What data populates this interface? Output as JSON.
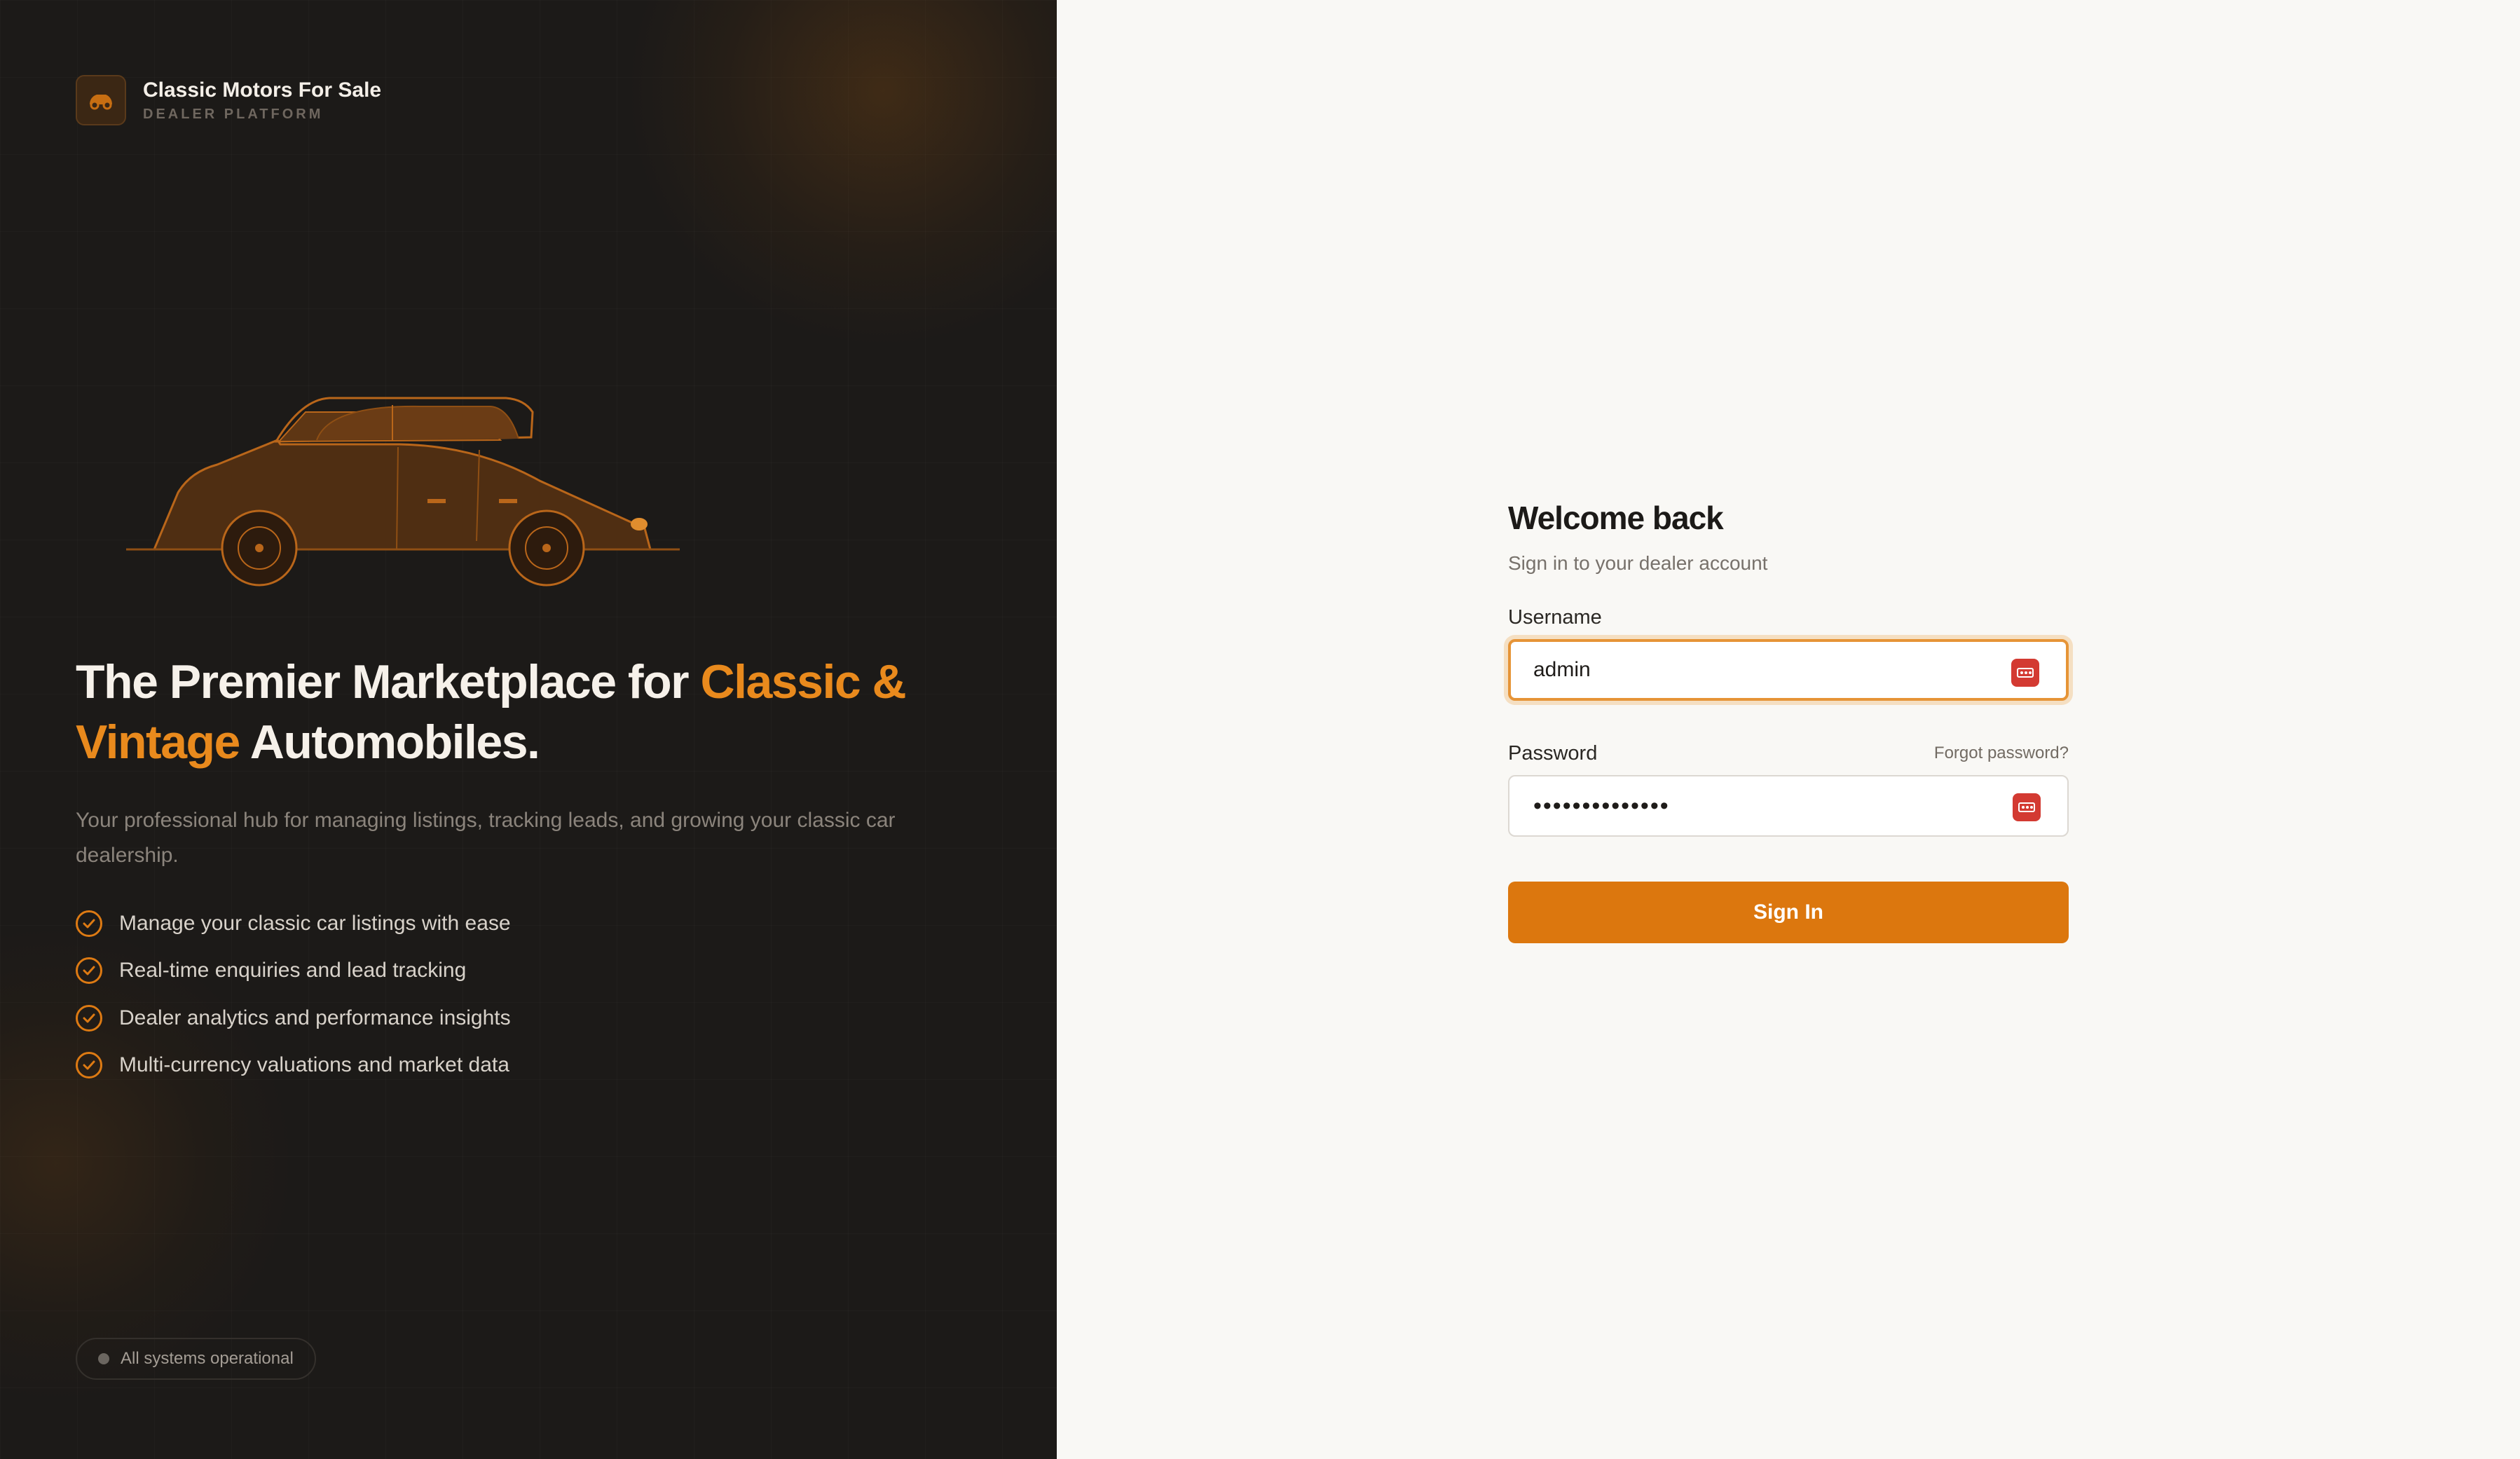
{
  "brand": {
    "name": "Classic Motors For Sale",
    "subtitle": "DEALER PLATFORM",
    "logo_icon": "car-icon"
  },
  "hero": {
    "headline_part1": "The Premier Marketplace for ",
    "headline_accent": "Classic & Vintage",
    "headline_part2": " Automobiles.",
    "description": "Your professional hub for managing listings, tracking leads, and growing your classic car dealership.",
    "illustration_icon": "vintage-car-icon"
  },
  "features": [
    "Manage your classic car listings with ease",
    "Real-time enquiries and lead tracking",
    "Dealer analytics and performance insights",
    "Multi-currency valuations and market data"
  ],
  "status": {
    "text": "All systems operational"
  },
  "login": {
    "title": "Welcome back",
    "subtitle": "Sign in to your dealer account",
    "username_label": "Username",
    "username_value": "admin",
    "password_label": "Password",
    "password_value": "••••••••••••••",
    "forgot_label": "Forgot password?",
    "submit_label": "Sign In",
    "password_manager_icon": "password-manager-icon"
  },
  "colors": {
    "accent": "#e98a1d",
    "button": "#dc770e",
    "left_bg": "#1c1a18",
    "right_bg": "#f9f8f5"
  }
}
